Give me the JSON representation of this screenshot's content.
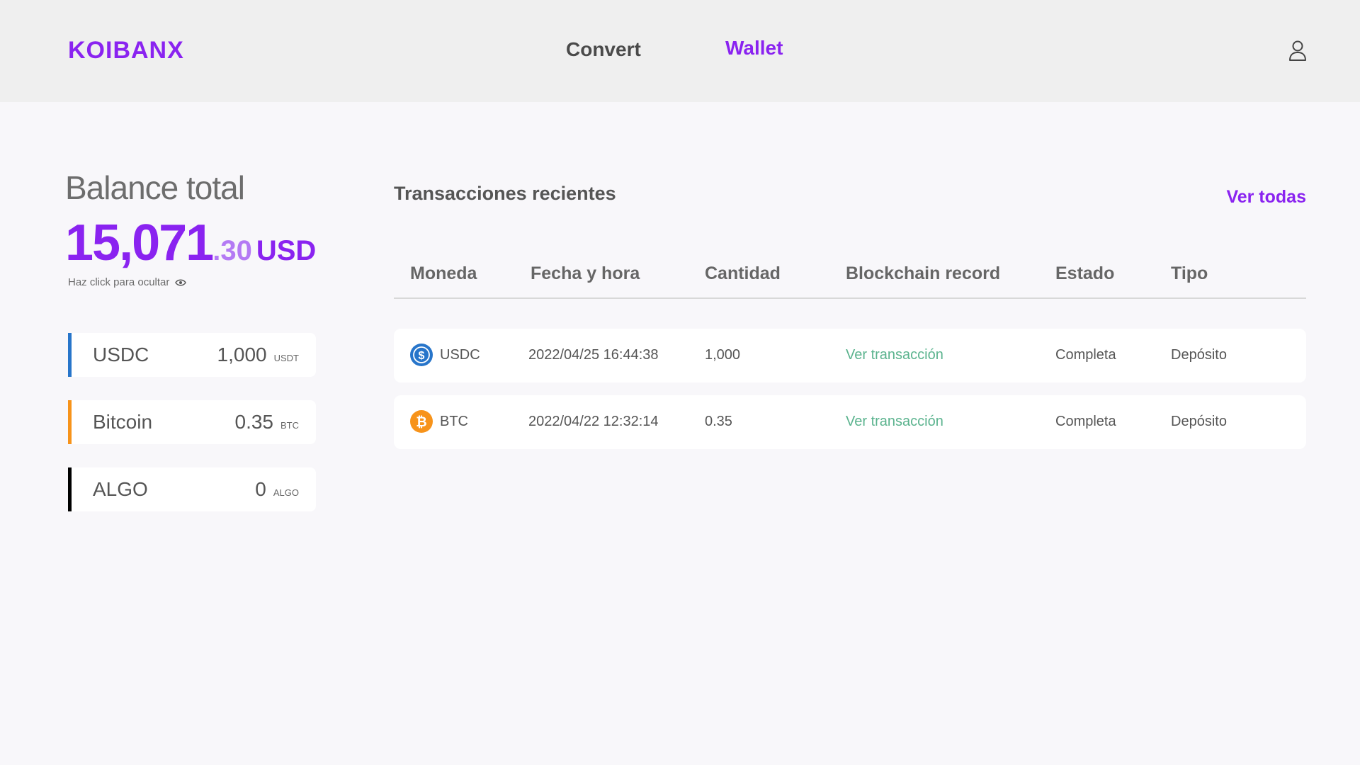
{
  "header": {
    "logo": "KOIBANX",
    "nav": [
      {
        "label": "Convert"
      },
      {
        "label": "Wallet"
      }
    ],
    "colors": {
      "brand": "#8a23f0",
      "background": "#efefef"
    }
  },
  "balance": {
    "title": "Balance total",
    "integer": "15,071",
    "decimals": ".30",
    "currency": "USD",
    "hide_hint": "Haz click para ocultar"
  },
  "assets": [
    {
      "name": "USDC",
      "amount": "1,000",
      "unit": "USDT",
      "accent": "#2775ca"
    },
    {
      "name": "Bitcoin",
      "amount": "0.35",
      "unit": "BTC",
      "accent": "#f7931a"
    },
    {
      "name": "ALGO",
      "amount": "0",
      "unit": "ALGO",
      "accent": "#000000"
    }
  ],
  "transactions": {
    "title": "Transacciones recientes",
    "see_all": "Ver todas",
    "columns": [
      "Moneda",
      "Fecha y hora",
      "Cantidad",
      "Blockchain record",
      "Estado",
      "Tipo"
    ],
    "rows": [
      {
        "icon": "usdc-icon",
        "coin": "USDC",
        "datetime": "2022/04/25  16:44:38",
        "amount": "1,000",
        "record": "Ver transacción",
        "status": "Completa",
        "type": "Depósito"
      },
      {
        "icon": "btc-icon",
        "coin": "BTC",
        "datetime": "2022/04/22  12:32:14",
        "amount": "0.35",
        "record": "Ver transacción",
        "status": "Completa",
        "type": "Depósito"
      }
    ]
  }
}
